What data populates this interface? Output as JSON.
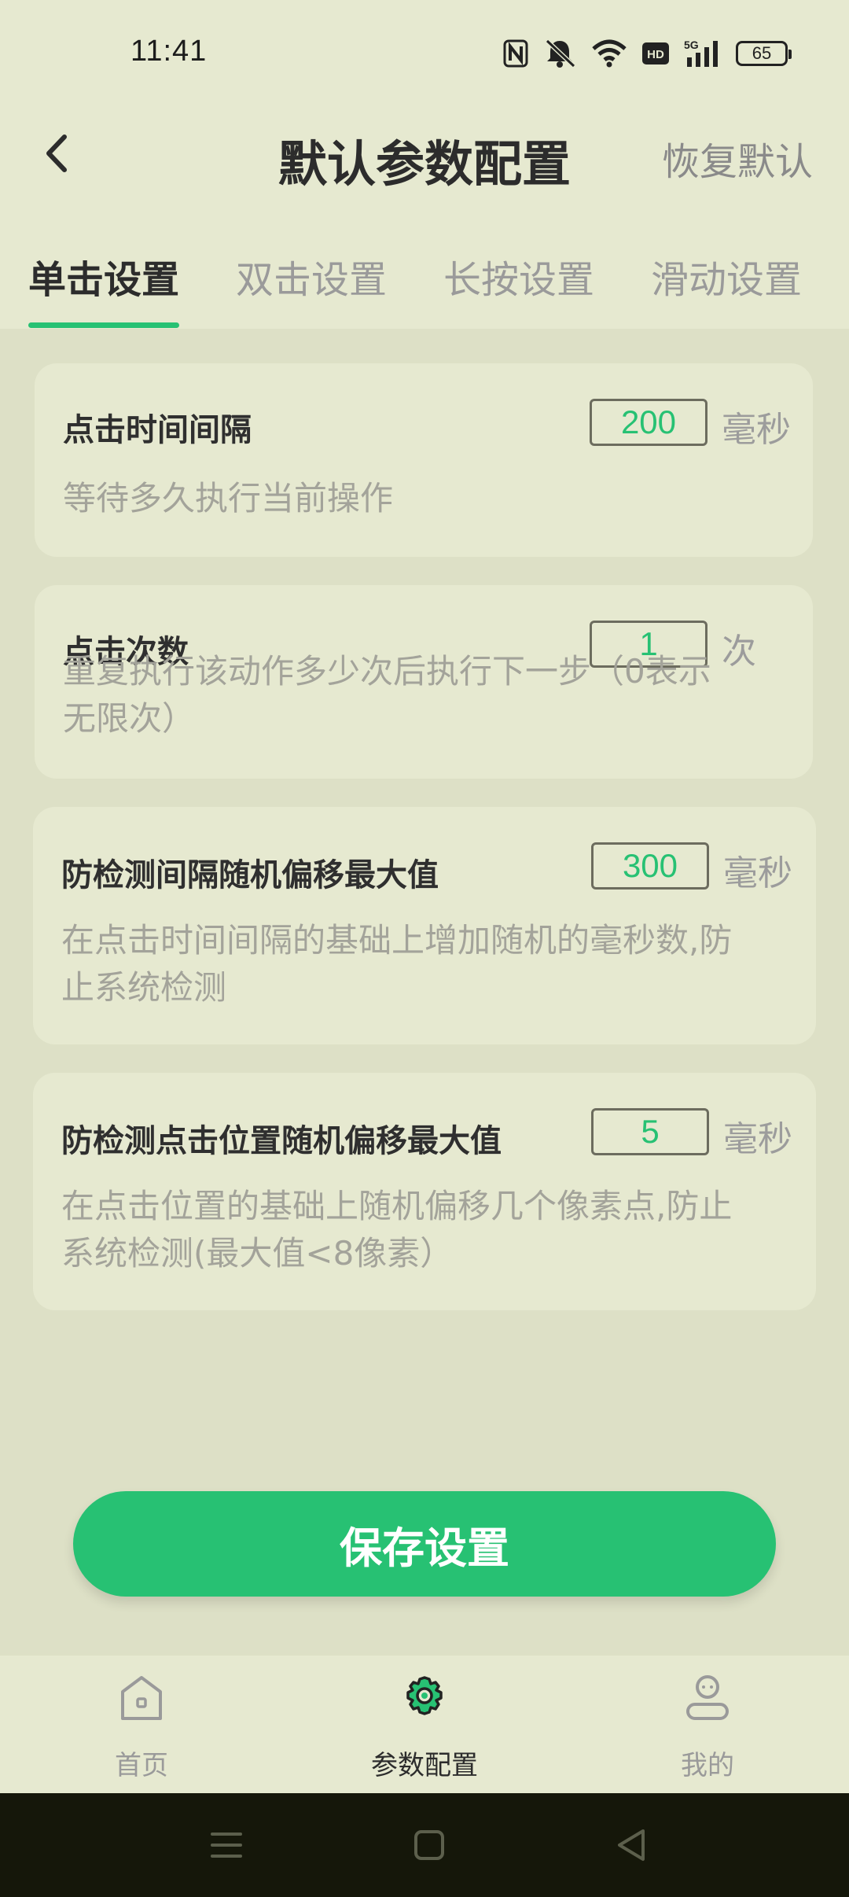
{
  "status_bar": {
    "time": "11:41",
    "battery": "65",
    "icons": [
      "nfc-icon",
      "mute-icon",
      "wifi-icon",
      "hd-icon",
      "5g-signal-icon",
      "battery-icon"
    ]
  },
  "header": {
    "title": "默认参数配置",
    "restore_label": "恢复默认"
  },
  "tabs": [
    {
      "label": "单击设置",
      "active": true
    },
    {
      "label": "双击设置",
      "active": false
    },
    {
      "label": "长按设置",
      "active": false
    },
    {
      "label": "滑动设置",
      "active": false
    }
  ],
  "settings": [
    {
      "title": "点击时间间隔",
      "value": "200",
      "unit": "毫秒",
      "description": "等待多久执行当前操作"
    },
    {
      "title": "点击次数",
      "value": "1",
      "unit": "次",
      "description_line1": "重复执行该动作多少次后执行下一步（0表示",
      "description_line2": "无限次）"
    },
    {
      "title": "防检测间隔随机偏移最大值",
      "value": "300",
      "unit": "毫秒",
      "description_line1": "在点击时间间隔的基础上增加随机的毫秒数,防",
      "description_line2": "止系统检测"
    },
    {
      "title": "防检测点击位置随机偏移最大值",
      "value": "5",
      "unit": "毫秒",
      "description_line1": "在点击位置的基础上随机偏移几个像素点,防止",
      "description_line2": "系统检测(最大值<8像素）"
    }
  ],
  "save_label": "保存设置",
  "bottom_nav": [
    {
      "label": "首页",
      "icon": "home-icon",
      "active": false
    },
    {
      "label": "参数配置",
      "icon": "gear-icon",
      "active": true
    },
    {
      "label": "我的",
      "icon": "profile-icon",
      "active": false
    }
  ],
  "colors": {
    "accent": "#27c173",
    "background": "#dde0c6",
    "card": "#e6e9d0"
  }
}
